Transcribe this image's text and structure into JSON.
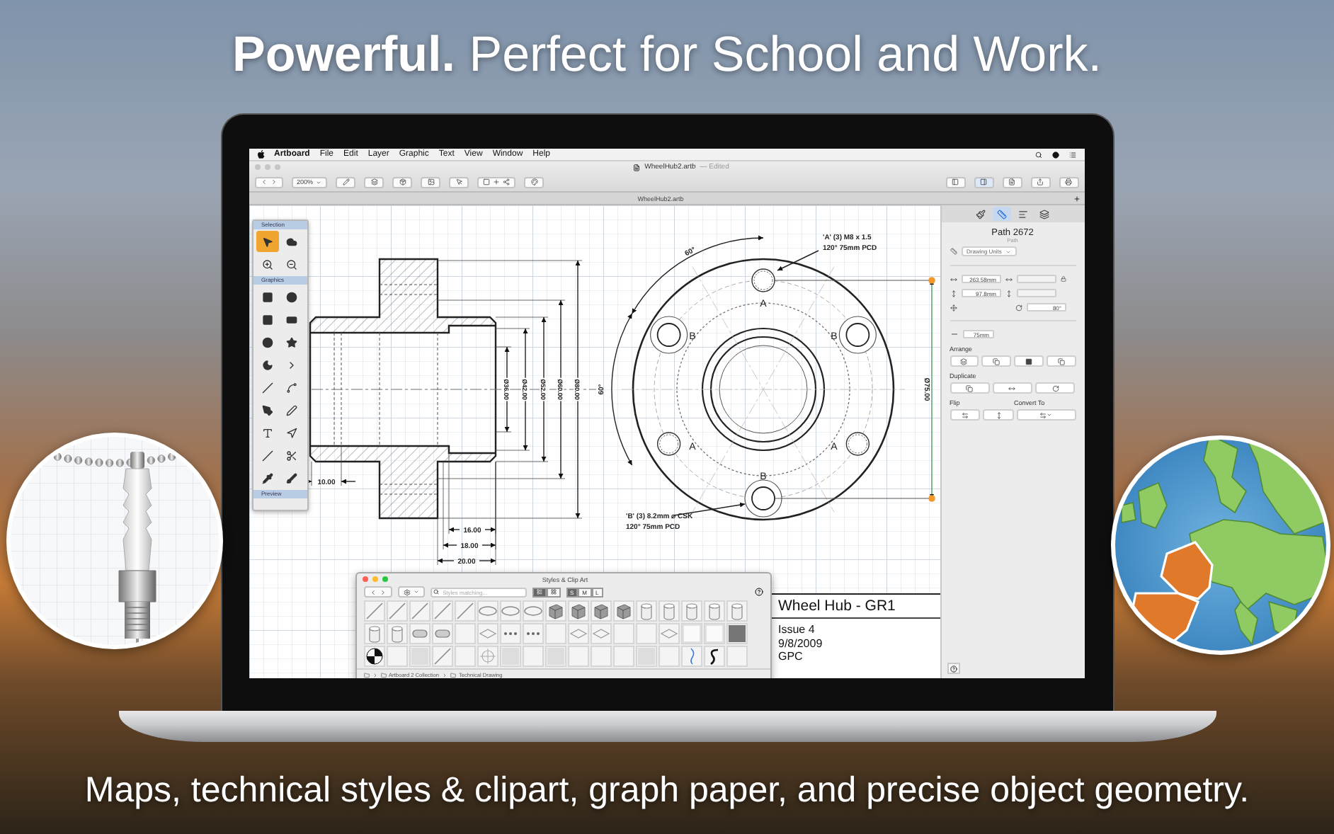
{
  "headline": "**Powerful.** Perfect for School and Work.",
  "menu_bar": {
    "app": "Artboard",
    "items": [
      "File",
      "Edit",
      "Layer",
      "Graphic",
      "Text",
      "View",
      "Window",
      "Help"
    ]
  },
  "window": {
    "title": "WheelHub2.artb",
    "status": "— Edited",
    "zoom": "200%",
    "tab": "WheelHub2.artb",
    "sidebar_toggles": [
      {
        "on": false
      },
      {
        "on": true
      }
    ]
  },
  "tool_palette": {
    "sections": [
      {
        "title": "Selection",
        "tools": [
          {
            "selected": true
          },
          {
            "selected": false
          },
          {
            "selected": false
          },
          {
            "selected": false
          }
        ]
      },
      {
        "title": "Graphics",
        "tools": [
          {
            "selected": false
          },
          {
            "selected": false
          },
          {
            "selected": false
          },
          {
            "selected": false
          },
          {
            "selected": false
          },
          {
            "selected": false
          },
          {
            "selected": false
          },
          {
            "selected": false
          },
          {
            "selected": false
          },
          {
            "selected": false
          },
          {
            "selected": false
          },
          {
            "selected": false
          },
          {
            "selected": false
          },
          {
            "selected": false
          },
          {
            "selected": false
          },
          {
            "selected": false
          },
          {
            "selected": false
          },
          {
            "selected": false
          }
        ]
      },
      {
        "title": "Preview"
      }
    ]
  },
  "drawing": {
    "diameters": [
      "Ø36.00",
      "Ø42.00",
      "Ø52.00",
      "Ø60.00",
      "Ø80.00"
    ],
    "lengths": [
      "10.00",
      "16.00",
      "18.00",
      "20.00"
    ],
    "angles": [
      "60°",
      "60°"
    ],
    "hole_labels": [
      "A",
      "B",
      "B",
      "A",
      "A",
      "B"
    ],
    "callouts": [
      {
        "lines": [
          "'A' (3) M8 x 1.5",
          "120° 75mm PCD"
        ]
      },
      {
        "lines": [
          "'B' (3) 8.2mm ⌀ CSK",
          "120° 75mm PCD"
        ]
      }
    ],
    "pcd": "Ø75.00"
  },
  "title_block": {
    "title": "Wheel Hub - GR1",
    "lines": [
      "Issue 4",
      "9/8/2009",
      "GPC"
    ]
  },
  "styles_window": {
    "title": "Styles & Clip Art",
    "search": {
      "placeholder": "Styles matching..."
    },
    "sizes": [
      {
        "label": "S",
        "selected": true
      },
      {
        "label": "M",
        "selected": false
      },
      {
        "label": "L",
        "selected": false
      }
    ],
    "breadcrumb": [
      "Artboard 2 Collection",
      "Technical Drawing"
    ]
  },
  "inspector": {
    "tabs": [
      {
        "selected": false
      },
      {
        "selected": true
      },
      {
        "selected": false
      },
      {
        "selected": false
      }
    ],
    "title": "Path 2672",
    "subtitle": "Path",
    "units": "Drawing Units",
    "x": "263.58mm",
    "y": "97.8mm",
    "angle": "80°",
    "stroke": "75mm",
    "sections": [
      "Arrange",
      "Duplicate",
      "Flip",
      "Convert To"
    ]
  },
  "caption": "Maps, technical styles & clipart, graph paper, and precise object geometry."
}
